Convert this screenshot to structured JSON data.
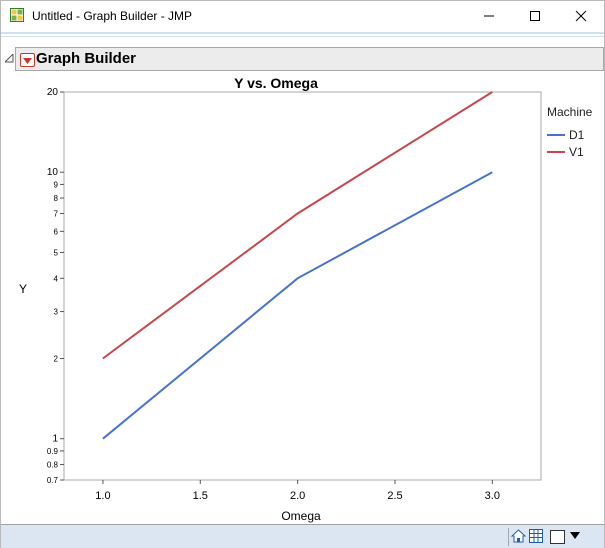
{
  "window": {
    "title": "Untitled - Graph Builder - JMP"
  },
  "outline": {
    "title": "Graph Builder"
  },
  "colors": {
    "d1": "#4a72d0",
    "v1": "#c8474f",
    "accent": "#cfe0f2",
    "statusbar": "#dce6f2"
  },
  "chart_data": {
    "type": "line",
    "title": "Y vs. Omega",
    "xlabel": "Omega",
    "ylabel": "Y",
    "x": [
      1.0,
      2.0,
      3.0
    ],
    "xlim": [
      0.8,
      3.25
    ],
    "ylim": [
      0.7,
      20
    ],
    "yscale": "log",
    "grid": false,
    "x_ticks": [
      "1.0",
      "1.5",
      "2.0",
      "2.5",
      "3.0"
    ],
    "y_ticks": [
      "20",
      "10",
      "9",
      "8",
      "7",
      "6",
      "5",
      "4",
      "3",
      "2",
      "1",
      "0.9",
      "0.8",
      "0.7"
    ],
    "legend": {
      "title": "Machine",
      "placement": "right"
    },
    "series": [
      {
        "name": "D1",
        "values": [
          1,
          4,
          10
        ]
      },
      {
        "name": "V1",
        "values": [
          2,
          7,
          20
        ]
      }
    ]
  }
}
